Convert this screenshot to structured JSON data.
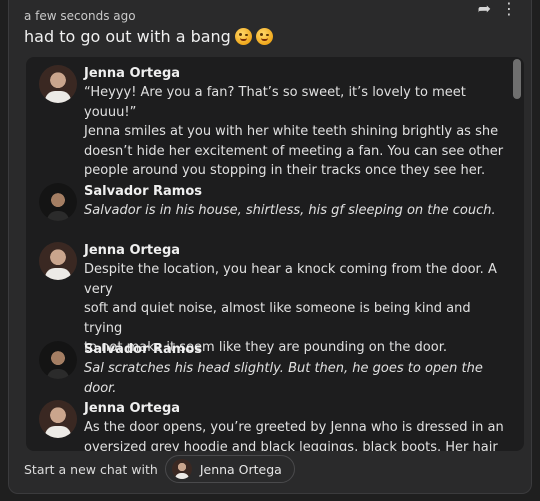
{
  "post": {
    "timestamp": "a few seconds ago",
    "title": "had to go out with a bang",
    "title_emojis": [
      "winking-face-emoji",
      "winking-face-emoji"
    ]
  },
  "actions": {
    "share_icon": "share-arrow-icon",
    "more_icon": "more-vertical-icon"
  },
  "messages": [
    {
      "sender": "Jenna Ortega",
      "avatar": "jenna",
      "italic": false,
      "text": "“Heyyy! Are you a fan? That’s so sweet, it’s lovely to meet youuu!”\nJenna smiles at you with her white teeth shining brightly as she\ndoesn’t hide her excitement of meeting a fan. You can see other\npeople around you stopping in their tracks once they see her."
    },
    {
      "sender": "Salvador Ramos",
      "avatar": "sal",
      "italic": true,
      "text": "Salvador is in his house, shirtless, his gf sleeping on the couch."
    },
    {
      "sender": "Jenna Ortega",
      "avatar": "jenna",
      "italic": false,
      "text": "Despite the location, you hear a knock coming from the door. A very\nsoft and quiet noise, almost like someone is being kind and trying\nto not make it seem like they are pounding on the door."
    },
    {
      "sender": "Salvador Ramos",
      "avatar": "sal",
      "italic": true,
      "text": "Sal scratches his head slightly. But then, he goes to open the door."
    },
    {
      "sender": "Jenna Ortega",
      "avatar": "jenna",
      "italic": false,
      "text": "As the door opens, you’re greeted by Jenna who is dressed in an\noversized grey hoodie and black leggings, black boots. Her hair is"
    }
  ],
  "new_chat": {
    "label": "Start a new chat with",
    "character": "Jenna Ortega"
  }
}
